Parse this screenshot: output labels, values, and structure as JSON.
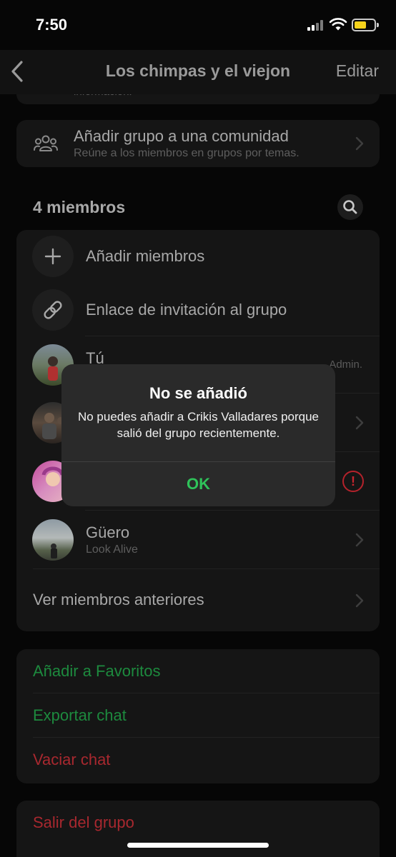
{
  "status_bar": {
    "time": "7:50"
  },
  "nav": {
    "title": "Los chimpas y el viejon",
    "edit_label": "Editar"
  },
  "info_stub": {
    "text": "información."
  },
  "community": {
    "title": "Añadir grupo a una comunidad",
    "subtitle": "Reúne a los miembros en grupos por temas."
  },
  "members": {
    "header": "4 miembros",
    "add_label": "Añadir miembros",
    "invite_label": "Enlace de invitación al grupo",
    "list": [
      {
        "name": "Tú",
        "status": "",
        "badge": "Admin."
      },
      {
        "name": "",
        "status": "",
        "badge": ""
      },
      {
        "name": "",
        "status": "",
        "badge": ""
      },
      {
        "name": "Güero",
        "status": "Look Alive",
        "badge": ""
      }
    ],
    "previous_label": "Ver miembros anteriores"
  },
  "actions": {
    "favorites": "Añadir a Favoritos",
    "export": "Exportar chat",
    "clear": "Vaciar chat",
    "exit": "Salir del grupo"
  },
  "dialog": {
    "title": "No se añadió",
    "message": "No puedes añadir a Crikis Valladares porque salió del grupo recientemente.",
    "ok_label": "OK"
  },
  "colors": {
    "accent_green": "#2fc35a",
    "action_green": "#1d8a3e",
    "destructive_red": "#a8282f",
    "battery_yellow": "#f5d21b"
  },
  "icons": {
    "back": "chevron-left-icon",
    "community": "people-group-icon",
    "search": "search-icon",
    "add": "plus-icon",
    "link": "link-icon",
    "alert": "exclamation-circle-icon",
    "chevron": "chevron-right-icon"
  }
}
